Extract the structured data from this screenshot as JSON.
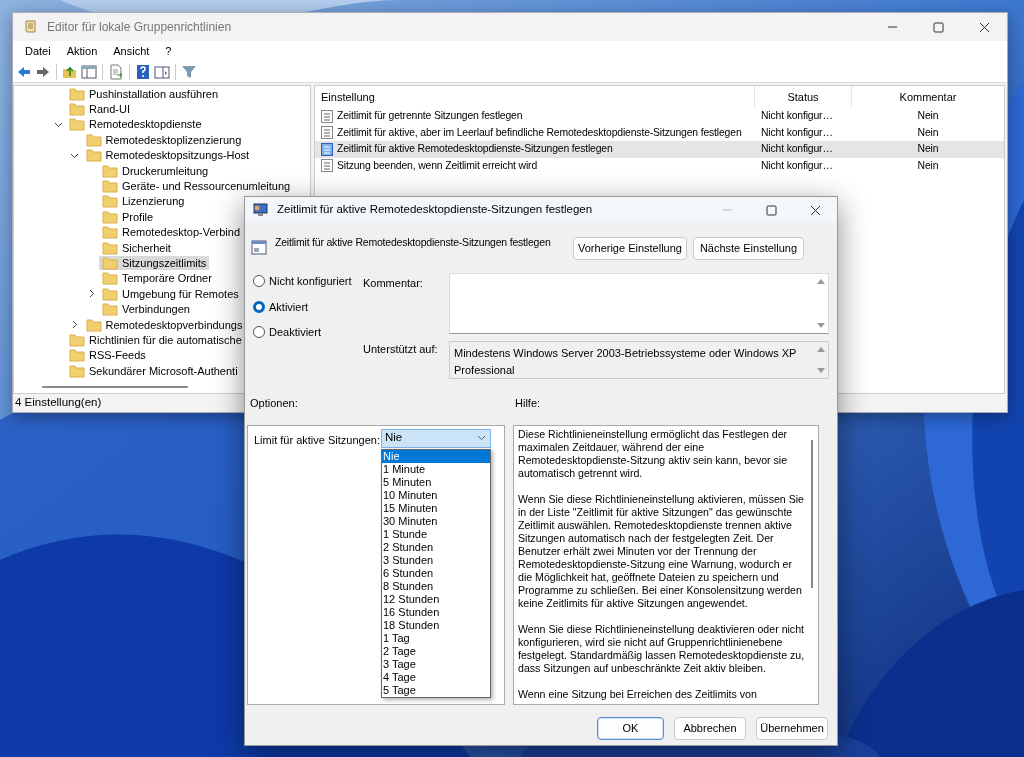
{
  "main_window": {
    "title": "Editor für lokale Gruppenrichtlinien",
    "menu": [
      "Datei",
      "Aktion",
      "Ansicht",
      "?"
    ],
    "tree": [
      {
        "label": "Pushinstallation ausführen",
        "selected": false
      },
      {
        "label": "Rand-UI",
        "selected": false
      },
      {
        "label": "Remotedesktopdienste",
        "selected": false,
        "expanded": true,
        "children": [
          {
            "label": "Remotedesktoplizenzierung",
            "selected": false
          },
          {
            "label": "Remotedesktopsitzungs-Host",
            "selected": false,
            "expanded": true,
            "children": [
              {
                "label": "Druckerumleitung",
                "selected": false
              },
              {
                "label": "Geräte- und Ressourcenumleitung",
                "selected": false
              },
              {
                "label": "Lizenzierung",
                "selected": false
              },
              {
                "label": "Profile",
                "selected": false
              },
              {
                "label": "Remotedesktop-Verbind",
                "selected": false
              },
              {
                "label": "Sicherheit",
                "selected": false
              },
              {
                "label": "Sitzungszeitlimits",
                "selected": true
              },
              {
                "label": "Temporäre Ordner",
                "selected": false
              },
              {
                "label": "Umgebung für Remotes",
                "selected": false,
                "expanded": false
              },
              {
                "label": "Verbindungen",
                "selected": false
              }
            ]
          },
          {
            "label": "Remotedesktopverbindungs",
            "selected": false,
            "expanded": false
          }
        ]
      },
      {
        "label": "Richtlinien für die automatische",
        "selected": false
      },
      {
        "label": "RSS-Feeds",
        "selected": false
      },
      {
        "label": "Sekundärer Microsoft-Authenti",
        "selected": false
      }
    ],
    "table": {
      "columns": [
        "Einstellung",
        "Status",
        "Kommentar"
      ],
      "rows": [
        {
          "name": "Zeitlimit für getrennte Sitzungen festlegen",
          "status": "Nicht konfigur…",
          "comment": "Nein",
          "selected": false
        },
        {
          "name": "Zeitlimit für aktive, aber im Leerlauf befindliche Remotedesktopdienste-Sitzungen festlegen",
          "status": "Nicht konfigur…",
          "comment": "Nein",
          "selected": false
        },
        {
          "name": "Zeitlimit für aktive Remotedesktopdienste-Sitzungen festlegen",
          "status": "Nicht konfigur…",
          "comment": "Nein",
          "selected": true
        },
        {
          "name": "Sitzung beenden, wenn Zeitlimit erreicht wird",
          "status": "Nicht konfigur…",
          "comment": "Nein",
          "selected": false
        }
      ]
    },
    "status_bar": "4 Einstellung(en)"
  },
  "dialog": {
    "title": "Zeitlimit für aktive Remotedesktopdienste-Sitzungen festlegen",
    "heading": "Zeitlimit für aktive Remotedesktopdienste-Sitzungen festlegen",
    "nav_buttons": [
      "Vorherige Einstellung",
      "Nächste Einstellung"
    ],
    "radios": [
      {
        "label": "Nicht konfiguriert",
        "selected": false
      },
      {
        "label": "Aktiviert",
        "selected": true
      },
      {
        "label": "Deaktiviert",
        "selected": false
      }
    ],
    "comment_label": "Kommentar:",
    "supported_label": "Unterstützt auf:",
    "supported_text": "Mindestens Windows Server 2003-Betriebssysteme oder Windows XP Professional",
    "options_label": "Optionen:",
    "help_label": "Hilfe:",
    "option": {
      "label": "Limit für aktive Sitzungen:",
      "value": "Nie",
      "expanded": true,
      "choices": [
        {
          "label": "Nie",
          "selected": true
        },
        {
          "label": "1 Minute",
          "selected": false
        },
        {
          "label": "5 Minuten",
          "selected": false
        },
        {
          "label": "10 Minuten",
          "selected": false
        },
        {
          "label": "15 Minuten",
          "selected": false
        },
        {
          "label": "30 Minuten",
          "selected": false
        },
        {
          "label": "1 Stunde",
          "selected": false
        },
        {
          "label": "2 Stunden",
          "selected": false
        },
        {
          "label": "3 Stunden",
          "selected": false
        },
        {
          "label": "6 Stunden",
          "selected": false
        },
        {
          "label": "8 Stunden",
          "selected": false
        },
        {
          "label": "12 Stunden",
          "selected": false
        },
        {
          "label": "16 Stunden",
          "selected": false
        },
        {
          "label": "18 Stunden",
          "selected": false
        },
        {
          "label": "1 Tag",
          "selected": false
        },
        {
          "label": "2 Tage",
          "selected": false
        },
        {
          "label": "3 Tage",
          "selected": false
        },
        {
          "label": "4 Tage",
          "selected": false
        },
        {
          "label": "5 Tage",
          "selected": false
        }
      ]
    },
    "help_paragraphs": [
      "Diese Richtlinieneinstellung ermöglicht das Festlegen der maximalen Zeitdauer, während der eine Remotedesktopdienste-Sitzung aktiv sein kann, bevor sie automatisch getrennt wird.",
      "Wenn Sie diese Richtlinieneinstellung aktivieren, müssen Sie in der Liste \"Zeitlimit für aktive Sitzungen\" das gewünschte Zeitlimit auswählen. Remotedesktopdienste trennen aktive Sitzungen automatisch nach der festgelegten Zeit. Der Benutzer erhält zwei Minuten vor der Trennung der Remotedesktopdienste-Sitzung eine Warnung, wodurch er die Möglichkeit hat, geöffnete Dateien zu speichern und Programme zu schließen. Bei einer Konsolensitzung werden keine Zeitlimits für aktive Sitzungen angewendet.",
      "Wenn Sie diese Richtlinieneinstellung deaktivieren oder nicht konfigurieren, wird sie nicht auf Gruppenrichtlinienebene festgelegt. Standardmäßig lassen Remotedesktopdienste zu, dass Sitzungen auf unbeschränkte Zeit aktiv bleiben.",
      "Wenn eine Sitzung bei Erreichen des Zeitlimits von"
    ],
    "buttons": [
      {
        "label": "OK",
        "default": true
      },
      {
        "label": "Abbrechen",
        "default": false
      },
      {
        "label": "Übernehmen",
        "default": false
      }
    ]
  }
}
